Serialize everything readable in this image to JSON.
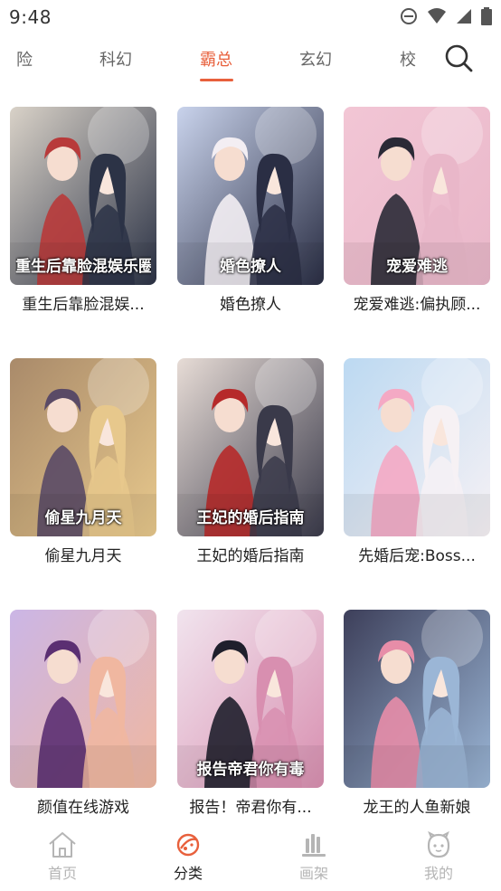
{
  "status_bar": {
    "time": "9:48"
  },
  "tabs": [
    {
      "label": "险",
      "active": false
    },
    {
      "label": "科幻",
      "active": false
    },
    {
      "label": "霸总",
      "active": true
    },
    {
      "label": "玄幻",
      "active": false
    },
    {
      "label": "校",
      "active": false
    }
  ],
  "comics": [
    {
      "title": "重生后靠脸混娱...",
      "cover_text": "重生后靠脸混娱乐圈",
      "palette": [
        "#d9d2c8",
        "#b83a3a",
        "#2c3346"
      ]
    },
    {
      "title": "婚色撩人",
      "cover_text": "婚色撩人",
      "palette": [
        "#c9d3ec",
        "#f3eef3",
        "#2a2e44"
      ]
    },
    {
      "title": "宠爱难逃:偏执顾...",
      "cover_text": "宠爱难逃",
      "palette": [
        "#f2c6d5",
        "#2a2a36",
        "#e9b7c9"
      ]
    },
    {
      "title": "偷星九月天",
      "cover_text": "偷星九月天",
      "palette": [
        "#a98a6a",
        "#5a4a66",
        "#e7c88c"
      ]
    },
    {
      "title": "王妃的婚后指南",
      "cover_text": "王妃的婚后指南",
      "palette": [
        "#e7dcd6",
        "#b62a2a",
        "#3a3a4a"
      ]
    },
    {
      "title": "先婚后宠:Boss...",
      "cover_text": "",
      "palette": [
        "#bcd9f2",
        "#f4a9c4",
        "#f6f1f4"
      ]
    },
    {
      "title": "颜值在线游戏",
      "cover_text": "",
      "palette": [
        "#cbb6e6",
        "#5b2f72",
        "#f0b7a0"
      ]
    },
    {
      "title": "报告！帝君你有...",
      "cover_text": "报告帝君你有毒",
      "palette": [
        "#f1e4ee",
        "#1f1f2c",
        "#d88fb0"
      ]
    },
    {
      "title": "龙王的人鱼新娘",
      "cover_text": "",
      "palette": [
        "#3d3f5a",
        "#e78da8",
        "#9bb6d6"
      ]
    }
  ],
  "bottom_nav": [
    {
      "label": "首页",
      "icon": "home-icon",
      "active": false
    },
    {
      "label": "分类",
      "icon": "category-planet-icon",
      "active": true
    },
    {
      "label": "画架",
      "icon": "bookshelf-icon",
      "active": false
    },
    {
      "label": "我的",
      "icon": "profile-face-icon",
      "active": false
    }
  ],
  "colors": {
    "accent": "#e8603c",
    "inactive": "#b5b5b5",
    "text": "#222222"
  }
}
